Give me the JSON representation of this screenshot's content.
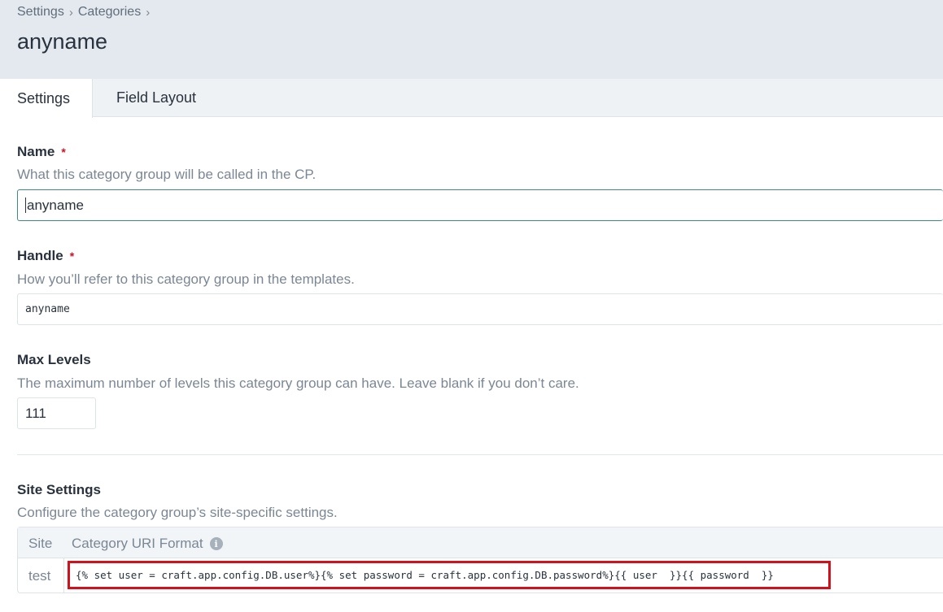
{
  "breadcrumb": {
    "items": [
      "Settings",
      "Categories"
    ],
    "separator": "›"
  },
  "page_title": "anyname",
  "tabs": [
    {
      "label": "Settings",
      "active": true
    },
    {
      "label": "Field Layout",
      "active": false
    }
  ],
  "fields": {
    "name": {
      "label": "Name",
      "required_mark": "*",
      "instructions": "What this category group will be called in the CP.",
      "value": "anyname"
    },
    "handle": {
      "label": "Handle",
      "required_mark": "*",
      "instructions": "How you’ll refer to this category group in the templates.",
      "value": "anyname"
    },
    "max_levels": {
      "label": "Max Levels",
      "instructions": "The maximum number of levels this category group can have. Leave blank if you don’t care.",
      "value": "111"
    }
  },
  "site_settings": {
    "label": "Site Settings",
    "instructions": "Configure the category group’s site-specific settings.",
    "columns": {
      "site": "Site",
      "uri_format": "Category URI Format"
    },
    "info_icon": "i",
    "rows": [
      {
        "site": "test",
        "uri_format": "{% set user = craft.app.config.DB.user%}{% set password = craft.app.config.DB.password%}{{ user  }}{{ password  }}"
      }
    ]
  },
  "colors": {
    "required": "#cf1124",
    "highlight_border": "#d3111d",
    "focus_border": "#3d8a84"
  }
}
